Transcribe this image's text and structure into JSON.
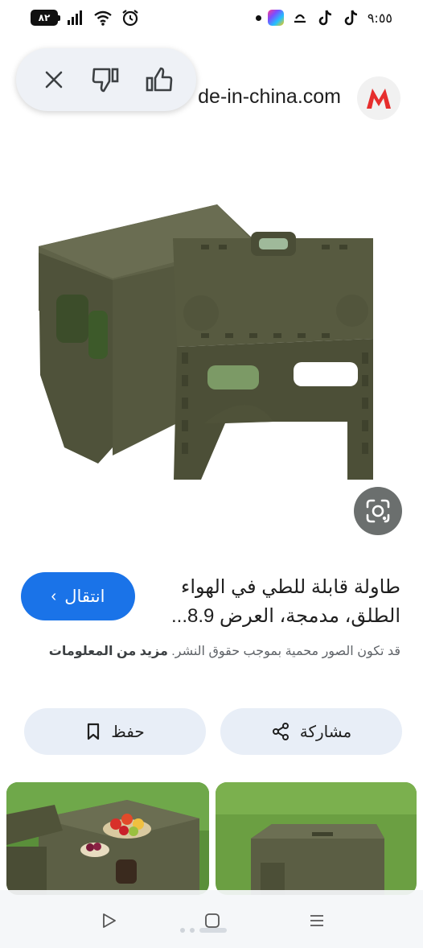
{
  "status_bar": {
    "battery": "٨٢",
    "time": "٩:٥٥",
    "icons": [
      "signal-icon",
      "wifi-icon",
      "alarm-icon",
      "tiktok-icon",
      "tiktok-icon",
      "cloud-icon",
      "app-icon"
    ]
  },
  "feedback": {
    "close_icon": "close-icon",
    "dislike_icon": "thumbs-down-icon",
    "like_icon": "thumbs-up-icon"
  },
  "source": {
    "name": "de-in-china.com",
    "logo_letter": "M",
    "logo_color": "#e62e2d"
  },
  "product": {
    "title": "طاولة قابلة للطي في الهواء الطلق، مدمجة، العرض 8.9...",
    "visit_label": "انتقال",
    "copyright_text": "قد تكون الصور محمية بموجب حقوق النشر.",
    "more_info_label": "مزيد من المعلومات"
  },
  "actions": {
    "save_label": "حفظ",
    "share_label": "مشاركة"
  },
  "colors": {
    "accent": "#1a73e8",
    "button_bg": "#e8eef7",
    "product_olive": "#5c5f45"
  }
}
